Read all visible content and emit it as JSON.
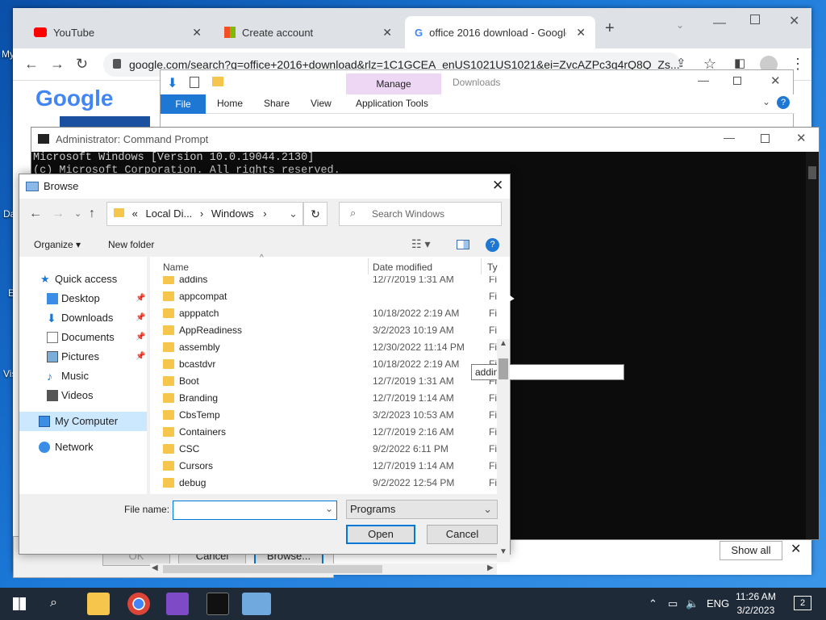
{
  "desktop": {
    "labels": [
      "My",
      "Da",
      "E",
      "Vis"
    ]
  },
  "chrome": {
    "tabs": [
      {
        "title": "YouTube",
        "close": "✕"
      },
      {
        "title": "Create account",
        "close": "✕"
      },
      {
        "title": "office 2016 download - Google ",
        "close": "✕"
      }
    ],
    "new_tab": "+",
    "url": "google.com/search?q=office+2016+download&rlz=1C1GCEA_enUS1021US1021&ei=ZvcAZPc3g4rQ8Q_Zs...",
    "logo": "Google"
  },
  "explorer": {
    "manage": "Manage",
    "title": "Downloads",
    "ribbon": [
      "File",
      "Home",
      "Share",
      "View",
      "Application Tools"
    ]
  },
  "cmd": {
    "title": "Administrator: Command Prompt",
    "lines": [
      "Microsoft Windows [Version 10.0.19044.2130]",
      "(c) Microsoft Corporation. All rights reserved."
    ]
  },
  "behind": {
    "ok": "OK",
    "cancel": "Cancel",
    "browse": "Browse...",
    "show_all": "Show all"
  },
  "browse": {
    "title": "Browse",
    "address": [
      "«",
      "Local Di...",
      "›",
      "Windows",
      "›"
    ],
    "search_placeholder": "Search Windows",
    "organize": "Organize ▾",
    "new_folder": "New folder",
    "nav": [
      {
        "label": "Quick access",
        "icon": "star-icon"
      },
      {
        "label": "Desktop",
        "icon": "desktop-icon"
      },
      {
        "label": "Downloads",
        "icon": "download-icon"
      },
      {
        "label": "Documents",
        "icon": "document-icon"
      },
      {
        "label": "Pictures",
        "icon": "pictures-icon"
      },
      {
        "label": "Music",
        "icon": "music-icon"
      },
      {
        "label": "Videos",
        "icon": "video-icon"
      },
      {
        "label": "My Computer",
        "icon": "computer-icon"
      },
      {
        "label": "Network",
        "icon": "network-icon"
      }
    ],
    "columns": {
      "name": "Name",
      "date": "Date modified",
      "type": "Ty"
    },
    "tooltip": "addins",
    "files": [
      {
        "name": "addins",
        "date": "12/7/2019 1:31 AM",
        "type": "Fi"
      },
      {
        "name": "appcompat",
        "date": "",
        "type": "Fi"
      },
      {
        "name": "apppatch",
        "date": "10/18/2022 2:19 AM",
        "type": "Fi"
      },
      {
        "name": "AppReadiness",
        "date": "3/2/2023 10:19 AM",
        "type": "Fi"
      },
      {
        "name": "assembly",
        "date": "12/30/2022 11:14 PM",
        "type": "Fi"
      },
      {
        "name": "bcastdvr",
        "date": "10/18/2022 2:19 AM",
        "type": "Fi"
      },
      {
        "name": "Boot",
        "date": "12/7/2019 1:31 AM",
        "type": "Fi"
      },
      {
        "name": "Branding",
        "date": "12/7/2019 1:14 AM",
        "type": "Fi"
      },
      {
        "name": "CbsTemp",
        "date": "3/2/2023 10:53 AM",
        "type": "Fi"
      },
      {
        "name": "Containers",
        "date": "12/7/2019 2:16 AM",
        "type": "Fi"
      },
      {
        "name": "CSC",
        "date": "9/2/2022 6:11 PM",
        "type": "Fi"
      },
      {
        "name": "Cursors",
        "date": "12/7/2019 1:14 AM",
        "type": "Fi"
      },
      {
        "name": "debug",
        "date": "9/2/2022 12:54 PM",
        "type": "Fi"
      }
    ],
    "file_name_label": "File name:",
    "file_name_value": "",
    "file_type": "Programs",
    "open": "Open",
    "cancel": "Cancel"
  },
  "taskbar": {
    "lang": "ENG",
    "time": "11:26 AM",
    "date": "3/2/2023",
    "notif": "2"
  }
}
